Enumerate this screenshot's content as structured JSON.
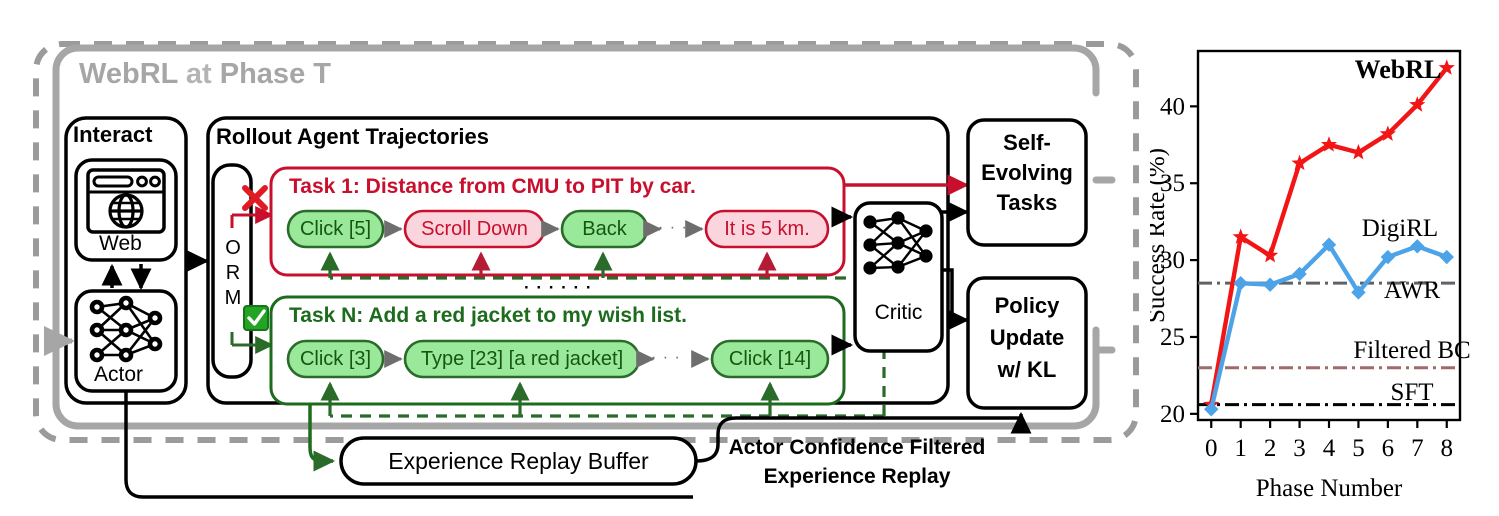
{
  "diagram": {
    "outer_title_parts": [
      "WebRL",
      "at",
      "Phase T"
    ],
    "interact": {
      "title": "Interact",
      "web_label": "Web",
      "actor_label": "Actor",
      "web_icon": "browser-globe-icon",
      "actor_icon": "neural-network-icon"
    },
    "rollout": {
      "title": "Rollout Agent Trajectories",
      "orm_label": "ORM",
      "ellipsis": "· · · · · ·",
      "task_fail": {
        "status_icon": "cross-icon",
        "title": "Task 1: Distance from CMU to PIT by car.",
        "steps": [
          "Click [5]",
          "Scroll Down",
          "Back",
          "It is 5 km."
        ],
        "step_types": [
          "ok",
          "bad",
          "ok",
          "bad"
        ],
        "step_ellipsis": "· · ·"
      },
      "task_pass": {
        "status_icon": "check-icon",
        "title": "Task N: Add a red jacket to my wish list.",
        "steps": [
          "Click [3]",
          "Type [23] [a red jacket]",
          "Click [14]"
        ],
        "step_types": [
          "ok",
          "ok",
          "ok"
        ],
        "step_ellipsis": "· · ·"
      }
    },
    "critic": {
      "label": "Critic",
      "icon": "neural-network-icon"
    },
    "self_evolving": {
      "lines": [
        "Self-",
        "Evolving",
        "Tasks"
      ]
    },
    "policy_update": {
      "lines": [
        "Policy",
        "Update",
        "w/ KL"
      ]
    },
    "replay_buffer": {
      "label": "Experience Replay Buffer"
    },
    "acfer": {
      "lines": [
        "Actor Confidence Filtered",
        "Experience Replay"
      ]
    },
    "colors": {
      "red": "#c8102e",
      "red_bright": "#ee1111",
      "pink_fill": "#fbd5dd",
      "green_dark": "#1d6b1d",
      "green_fill": "#9ae89a",
      "green_line": "#1f7a1f",
      "gray": "#a6a6a6",
      "black": "#000000",
      "arrow_gray": "#666666"
    }
  },
  "chart_data": {
    "type": "line",
    "title": "",
    "xlabel": "Phase Number",
    "ylabel": "Success Rate (%)",
    "x": [
      0,
      1,
      2,
      3,
      4,
      5,
      6,
      7,
      8
    ],
    "xlim": [
      -0.45,
      8.45
    ],
    "ylim": [
      19.6,
      43.6
    ],
    "yticks": [
      20,
      25,
      30,
      35,
      40
    ],
    "ytick_labels": [
      "20",
      "25",
      "30",
      "35",
      "40"
    ],
    "xtick_labels": [
      "0",
      "1",
      "2",
      "3",
      "4",
      "5",
      "6",
      "7",
      "8"
    ],
    "grid": false,
    "legend": "inline-annotations",
    "series": [
      {
        "name": "WebRL",
        "color": "#f21515",
        "marker": "star",
        "label_pos": "top-right",
        "values": [
          20.6,
          31.5,
          30.3,
          36.3,
          37.5,
          37.0,
          38.2,
          40.1,
          42.5
        ]
      },
      {
        "name": "DigiRL",
        "color": "#4da3e8",
        "marker": "diamond",
        "label_pos": "mid-right",
        "values": [
          20.3,
          28.5,
          28.4,
          29.1,
          31.0,
          27.9,
          30.2,
          30.9,
          30.2
        ]
      }
    ],
    "hlines": [
      {
        "name": "AWR",
        "value": 28.5,
        "color": "#5f6368",
        "style": "dashdot"
      },
      {
        "name": "Filtered BC",
        "value": 23.0,
        "color": "#a06a6a",
        "style": "dashdot"
      },
      {
        "name": "SFT",
        "value": 20.6,
        "color": "#000000",
        "style": "dashdot"
      }
    ]
  }
}
